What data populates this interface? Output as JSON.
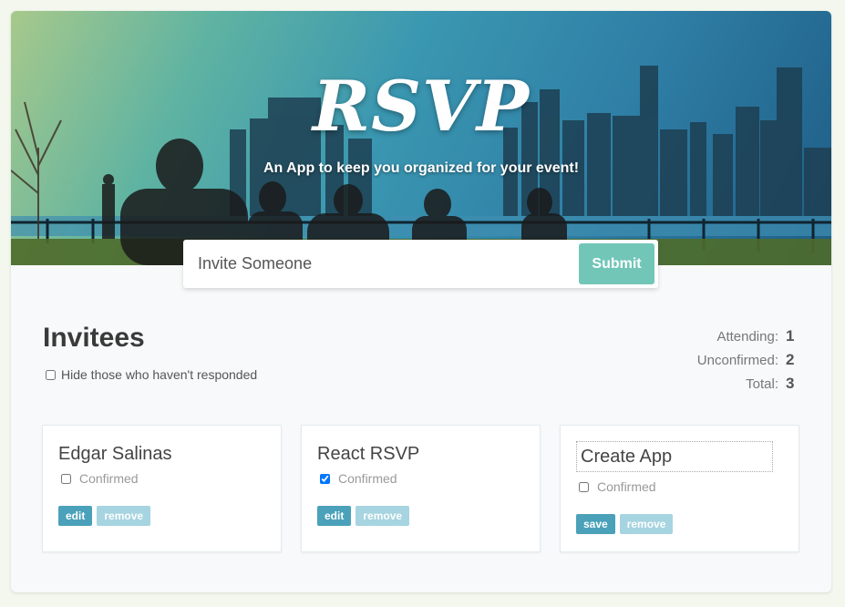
{
  "header": {
    "logo": "RSVP",
    "tagline": "An App to keep you organized for your event!"
  },
  "invite_form": {
    "placeholder": "Invite Someone",
    "submit_label": "Submit"
  },
  "invitees": {
    "title": "Invitees",
    "hide_filter_label": "Hide those who haven't responded"
  },
  "counter": {
    "attending_label": "Attending:",
    "attending_value": "1",
    "unconfirmed_label": "Unconfirmed:",
    "unconfirmed_value": "2",
    "total_label": "Total:",
    "total_value": "3"
  },
  "cards": [
    {
      "name": "Edgar Salinas",
      "confirmed_label": "Confirmed",
      "confirmed": false,
      "action_label": "edit",
      "remove_label": "remove"
    },
    {
      "name": "React RSVP",
      "confirmed_label": "Confirmed",
      "confirmed": true,
      "action_label": "edit",
      "remove_label": "remove"
    },
    {
      "name": "Create App",
      "confirmed_label": "Confirmed",
      "confirmed": false,
      "action_label": "save",
      "remove_label": "remove"
    }
  ],
  "colors": {
    "accent": "#4aa1b9",
    "accent_muted": "#a6d4e0",
    "submit": "#71c6b8"
  }
}
